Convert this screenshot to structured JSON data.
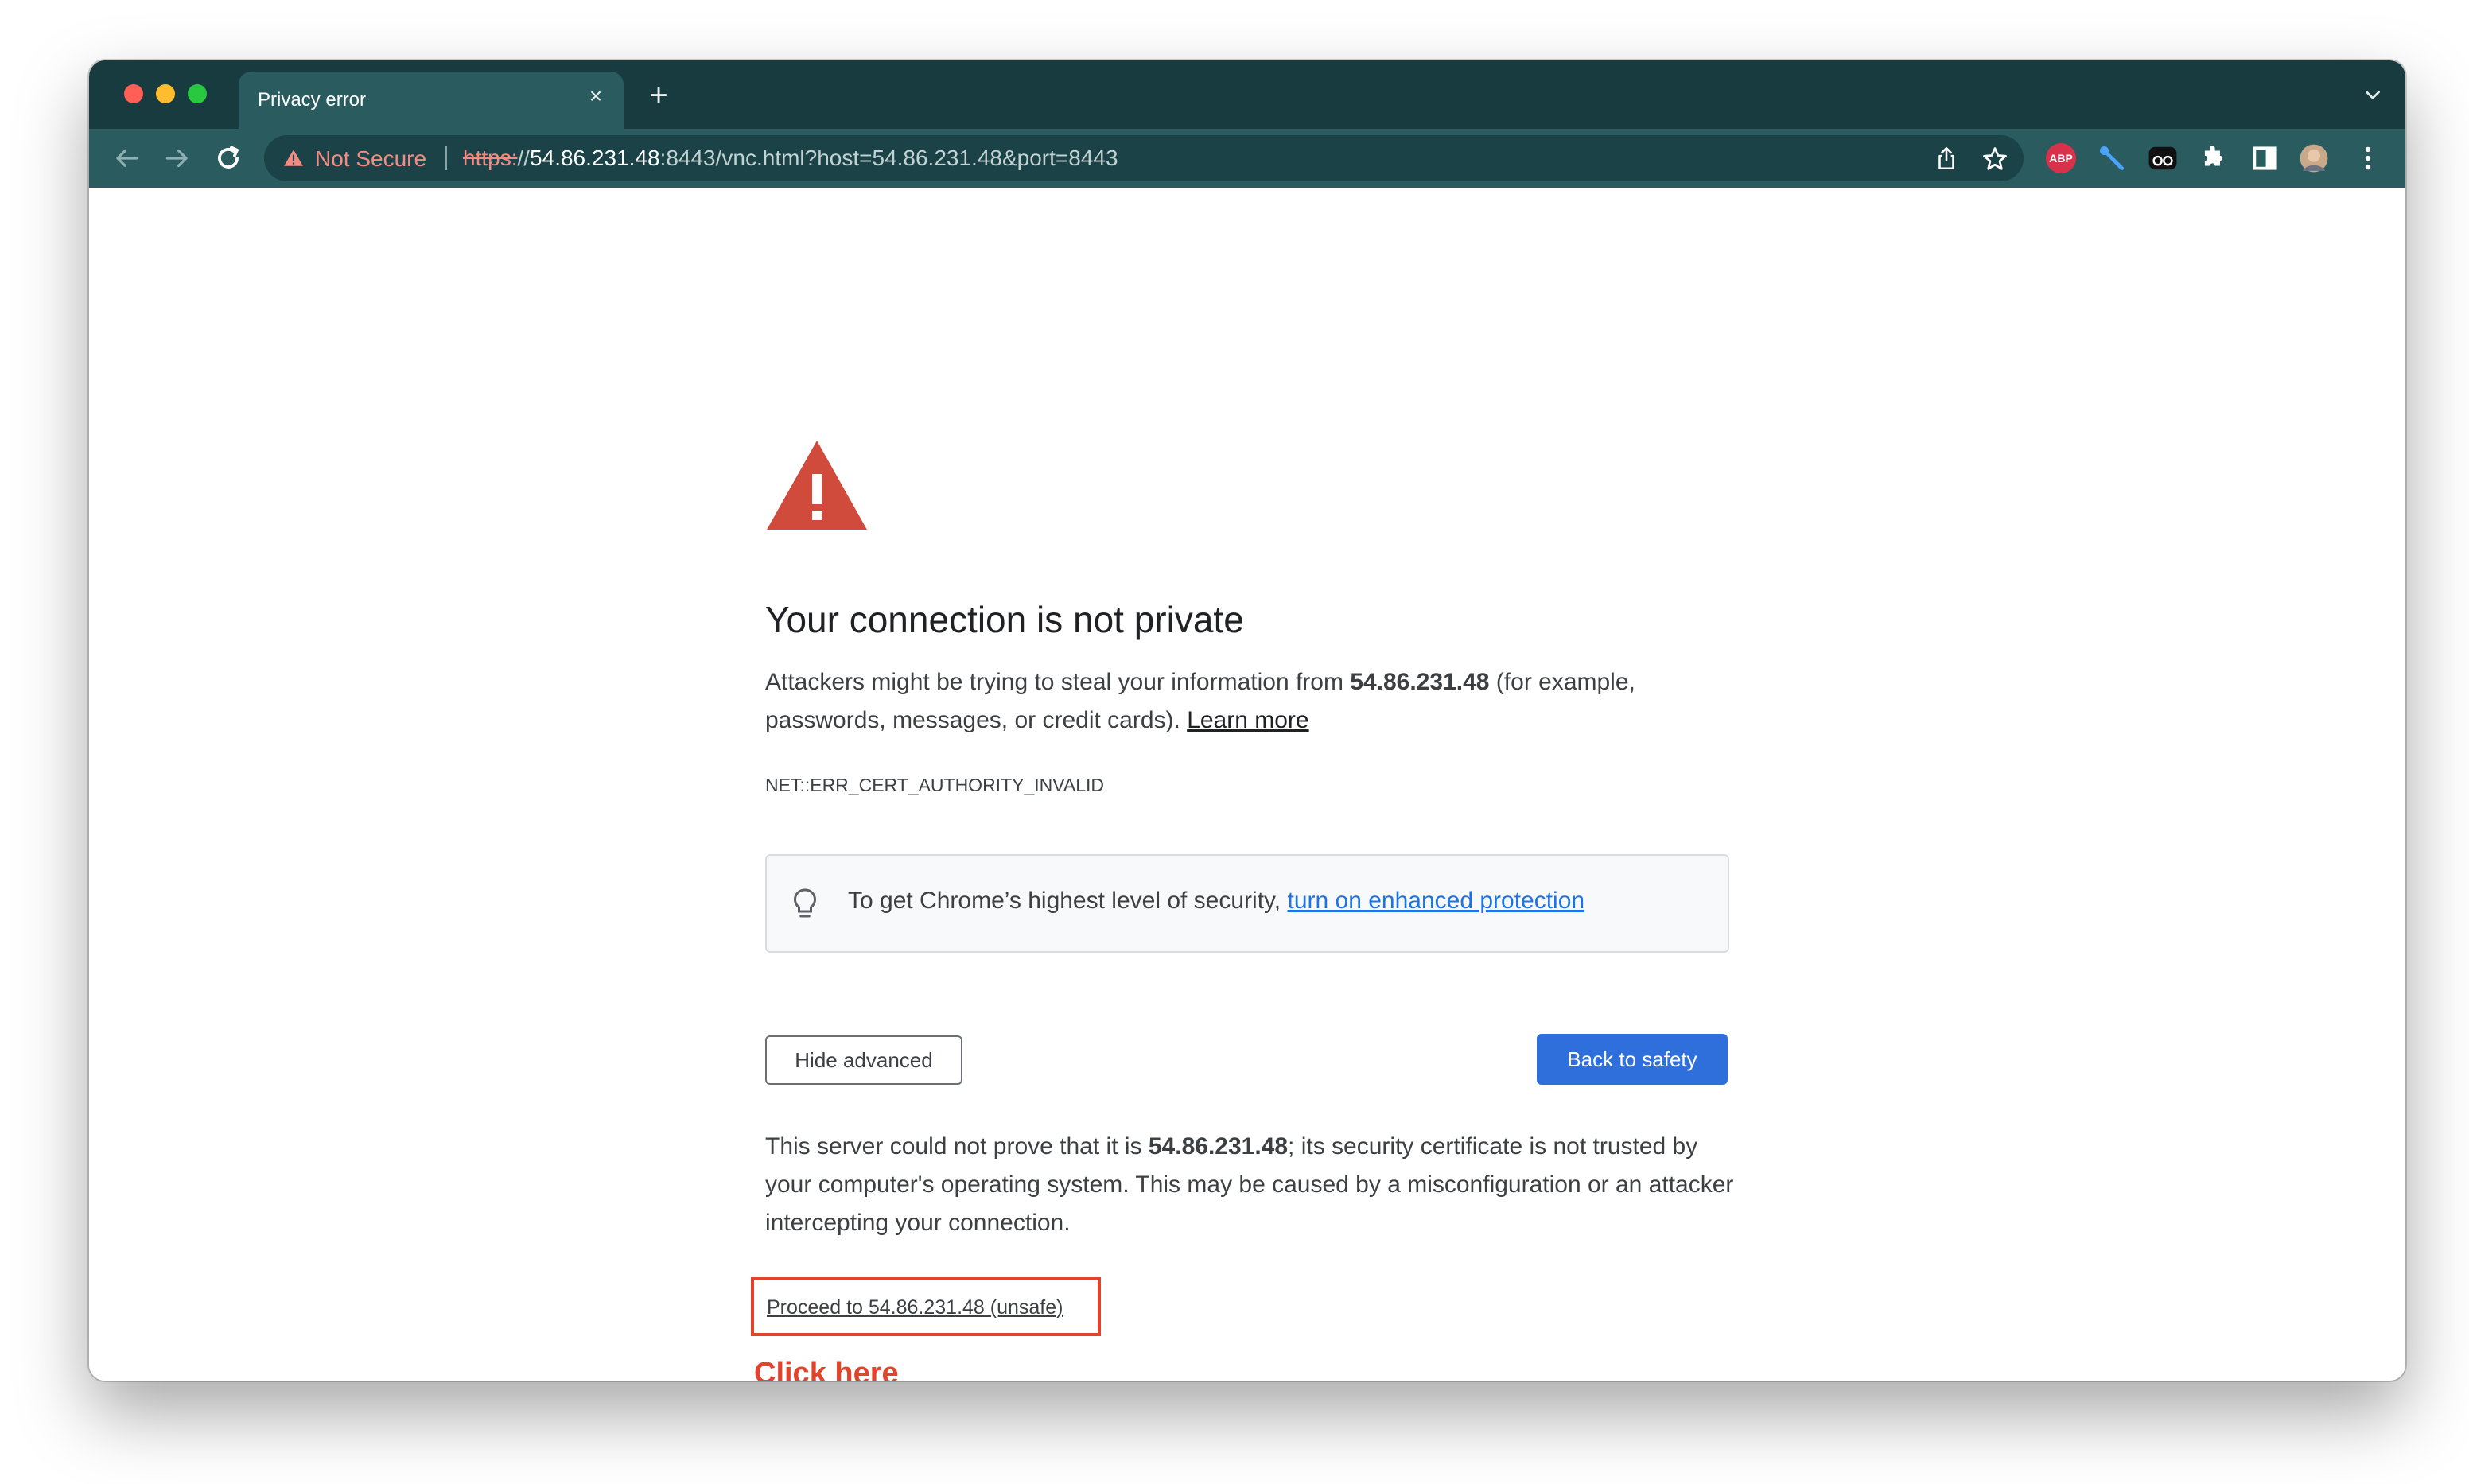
{
  "browser": {
    "tab": {
      "title": "Privacy error",
      "close_glyph": "×"
    },
    "new_tab_glyph": "+",
    "tabstrip_menu_icon": "chevron-down-icon",
    "toolbar": {
      "back_icon": "arrow-left-icon",
      "forward_icon": "arrow-right-icon",
      "reload_icon": "reload-icon",
      "share_icon": "share-icon",
      "bookmark_icon": "star-icon",
      "extensions": [
        "ABP",
        "wrench-icon",
        "glasses-icon",
        "puzzle-icon",
        "sidebar-icon",
        "avatar",
        "kebab-menu-icon"
      ],
      "abp_label": "ABP"
    },
    "omnibox": {
      "security_label": "Not Secure",
      "url_scheme": "https:",
      "url_slashes": "//",
      "url_host": "54.86.231.48",
      "url_rest": ":8443/vnc.html?host=54.86.231.48&port=8443"
    }
  },
  "page": {
    "heading": "Your connection is not private",
    "intro": {
      "before_host": "Attackers might be trying to steal your information from ",
      "host": "54.86.231.48",
      "after_host": " (for example, passwords, messages, or credit cards). ",
      "learn_more": "Learn more"
    },
    "error_code": "NET::ERR_CERT_AUTHORITY_INVALID",
    "enhanced": {
      "text": "To get Chrome’s highest level of security, ",
      "link": "turn on enhanced protection"
    },
    "buttons": {
      "hide_advanced": "Hide advanced",
      "back_to_safety": "Back to safety"
    },
    "details": {
      "before_host": "This server could not prove that it is ",
      "host": "54.86.231.48",
      "after_host": "; its security certificate is not trusted by your computer's operating system. This may be caused by a misconfiguration or an attacker intercepting your connection."
    },
    "proceed_link": "Proceed to 54.86.231.48 (unsafe)",
    "annotation": "Click here"
  },
  "colors": {
    "tabstrip": "#173b3f",
    "toolbar": "#2a5b5f",
    "warning_red": "#d04b3b",
    "primary_blue": "#2f6fdc",
    "annotation_red": "#e2432d"
  }
}
